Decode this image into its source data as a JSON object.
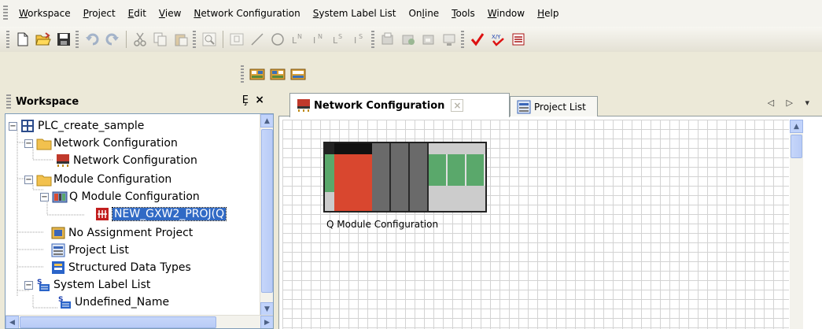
{
  "menu": {
    "items": [
      {
        "label": "Workspace",
        "mnemonic_index": 0
      },
      {
        "label": "Project",
        "mnemonic_index": 0
      },
      {
        "label": "Edit",
        "mnemonic_index": 0
      },
      {
        "label": "View",
        "mnemonic_index": 0
      },
      {
        "label": "Network Configuration",
        "mnemonic_index": 0
      },
      {
        "label": "System Label List",
        "mnemonic_index": 0
      },
      {
        "label": "Online",
        "mnemonic_index": 2
      },
      {
        "label": "Tools",
        "mnemonic_index": 0
      },
      {
        "label": "Window",
        "mnemonic_index": 0
      },
      {
        "label": "Help",
        "mnemonic_index": 0
      }
    ]
  },
  "toolbar": {
    "row1_icons": [
      "new-icon",
      "open-icon",
      "save-icon",
      "undo-icon",
      "redo-icon",
      "cut-icon",
      "copy-icon",
      "paste-icon",
      "zoom-icon",
      "label-icon",
      "line-icon",
      "circle-icon",
      "text-ln-icon",
      "text-in-icon",
      "text-ls-icon",
      "text-is-icon",
      "write-plc-icon",
      "read-plc-icon",
      "verify-icon",
      "monitor-icon",
      "check-icon",
      "check-all-icon",
      "check-list-icon"
    ],
    "row2_icons": [
      "network-param-1-icon",
      "network-param-2-icon",
      "network-param-3-icon"
    ]
  },
  "workspace": {
    "title": "Workspace",
    "pin_glyph": "Ȩ",
    "close_glyph": "×",
    "tree": [
      {
        "label": "PLC_create_sample",
        "icon": "project-root-icon",
        "expander": "−"
      },
      {
        "label": "Network Configuration",
        "icon": "folder-icon",
        "expander": "−"
      },
      {
        "label": "Network Configuration",
        "icon": "network-config-icon"
      },
      {
        "label": "Module Configuration",
        "icon": "folder-icon",
        "expander": "−"
      },
      {
        "label": "Q Module Configuration",
        "icon": "q-module-icon",
        "expander": "−"
      },
      {
        "label": "NEW_GXW2_PROJ(Q",
        "icon": "plc-project-icon",
        "selected": true
      },
      {
        "label": "No Assignment Project",
        "icon": "no-assign-icon"
      },
      {
        "label": "Project List",
        "icon": "project-list-icon"
      },
      {
        "label": "Structured Data Types",
        "icon": "data-types-icon"
      },
      {
        "label": "System Label List",
        "icon": "system-label-icon",
        "expander": "−"
      },
      {
        "label": "Undefined_Name",
        "icon": "undefined-label-icon"
      }
    ]
  },
  "tabs": [
    {
      "label": "Network Configuration",
      "active": true,
      "close_glyph": "×"
    },
    {
      "label": "Project List",
      "active": false
    }
  ],
  "tab_nav": "◁ ▷ ▾",
  "canvas": {
    "module_label": "Q Module Configuration"
  },
  "colors": {
    "selection": "#316ac5",
    "cpu_red": "#d9472f",
    "slot_green": "#5aa86b",
    "grid": "#d3d3d3"
  }
}
